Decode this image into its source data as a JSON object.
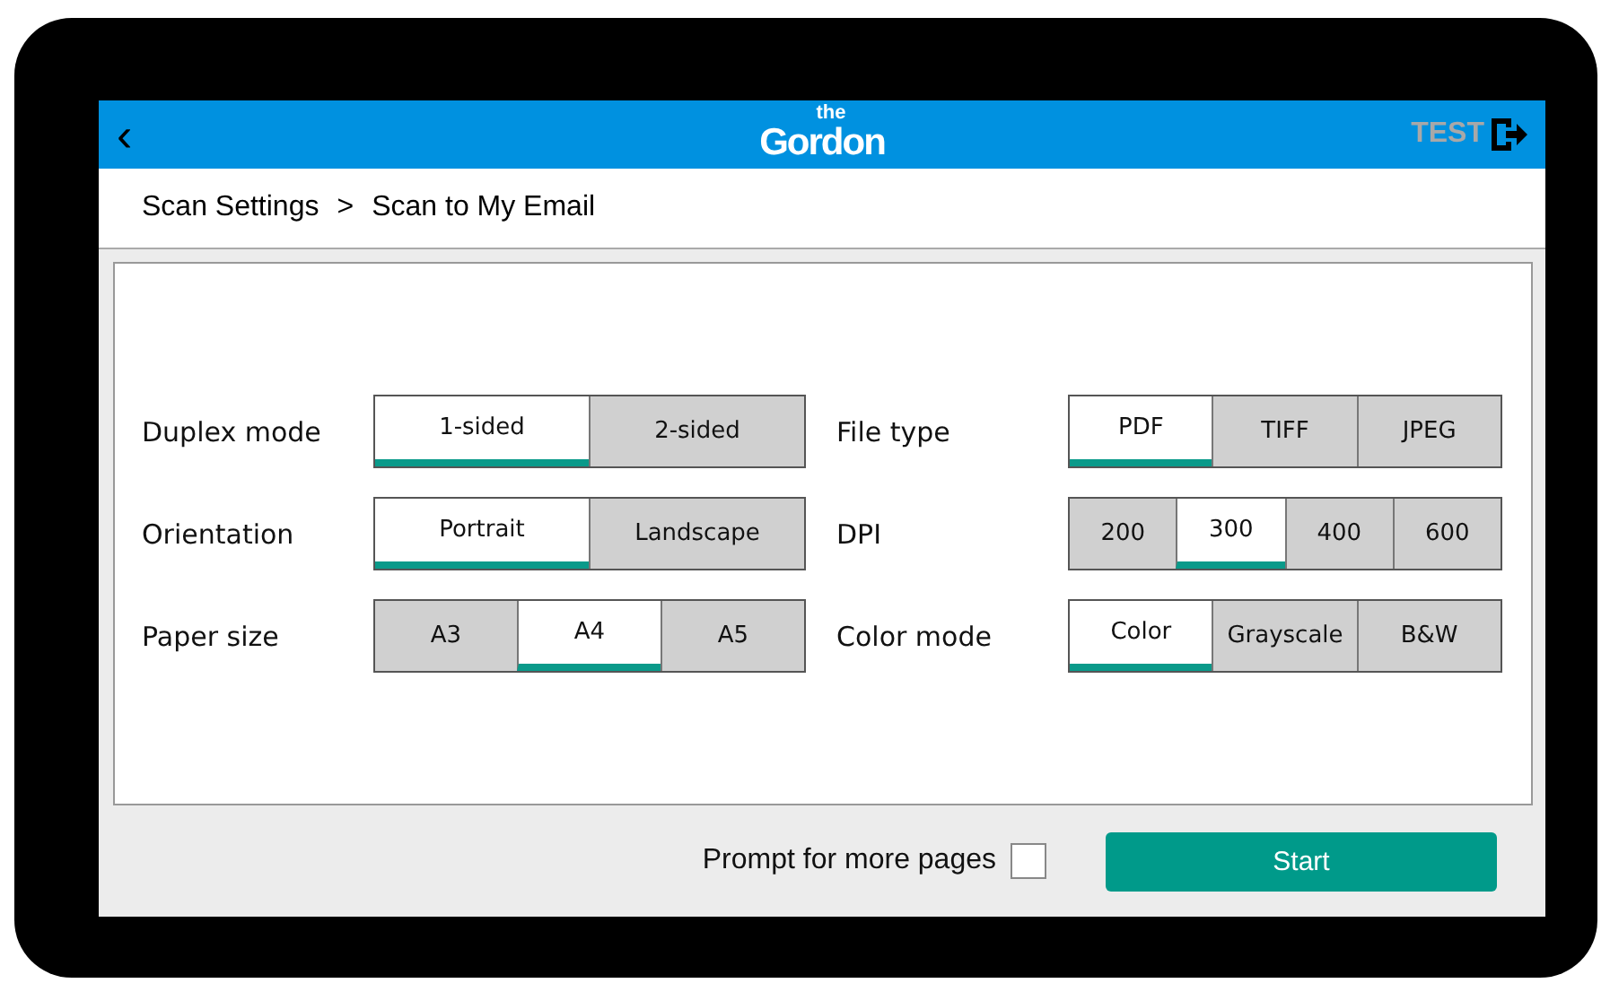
{
  "header": {
    "back": "‹",
    "logo": {
      "top": "the",
      "main": "Gordon"
    },
    "user": "TEST"
  },
  "breadcrumb": [
    "Scan Settings",
    ">",
    "Scan to My Email"
  ],
  "settings": [
    {
      "label": "Duplex mode",
      "options": [
        {
          "label": "1-sided",
          "selected": true
        },
        {
          "label": "2-sided",
          "selected": false
        }
      ]
    },
    {
      "label": "File type",
      "options": [
        {
          "label": "PDF",
          "selected": true
        },
        {
          "label": "TIFF",
          "selected": false
        },
        {
          "label": "JPEG",
          "selected": false
        }
      ]
    },
    {
      "label": "Orientation",
      "options": [
        {
          "label": "Portrait",
          "selected": true
        },
        {
          "label": "Landscape",
          "selected": false
        }
      ]
    },
    {
      "label": "DPI",
      "options": [
        {
          "label": "200",
          "selected": false
        },
        {
          "label": "300",
          "selected": true
        },
        {
          "label": "400",
          "selected": false
        },
        {
          "label": "600",
          "selected": false
        }
      ]
    },
    {
      "label": "Paper size",
      "options": [
        {
          "label": "A3",
          "selected": false
        },
        {
          "label": "A4",
          "selected": true
        },
        {
          "label": "A5",
          "selected": false
        }
      ]
    },
    {
      "label": "Color mode",
      "options": [
        {
          "label": "Color",
          "selected": true
        },
        {
          "label": "Grayscale",
          "selected": false
        },
        {
          "label": "B&W",
          "selected": false
        }
      ]
    }
  ],
  "footer": {
    "prompt": {
      "label": "Prompt for more pages",
      "checked": false
    },
    "start": "Start"
  }
}
